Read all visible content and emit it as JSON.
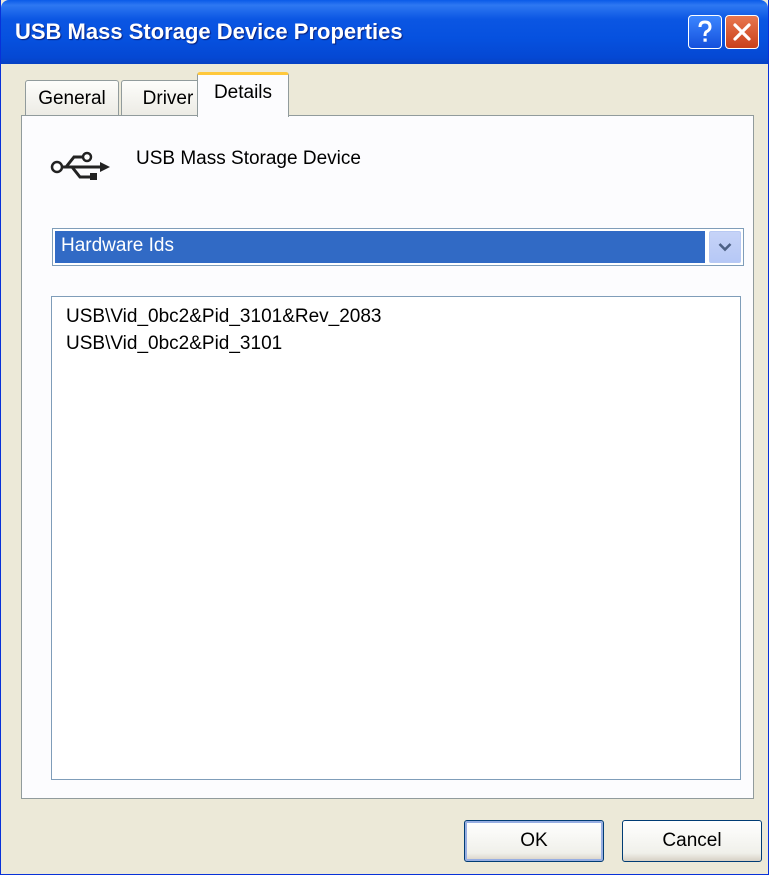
{
  "window": {
    "title": "USB Mass Storage Device Properties",
    "help_label": "?",
    "close_label": "Close"
  },
  "tabs": [
    {
      "label": "General",
      "selected": false
    },
    {
      "label": "Driver",
      "selected": false
    },
    {
      "label": "Details",
      "selected": true
    }
  ],
  "details": {
    "device_icon": "usb-icon",
    "device_name": "USB Mass Storage Device",
    "property_select": {
      "selected_value": "Hardware Ids"
    },
    "values": [
      "USB\\Vid_0bc2&Pid_3101&Rev_2083",
      "USB\\Vid_0bc2&Pid_3101"
    ]
  },
  "buttons": {
    "ok_label": "OK",
    "cancel_label": "Cancel"
  },
  "colors": {
    "titlebar": "#0651df",
    "selection": "#316ac5",
    "tab_highlight": "#ffc83c",
    "close_button": "#c9401b"
  }
}
